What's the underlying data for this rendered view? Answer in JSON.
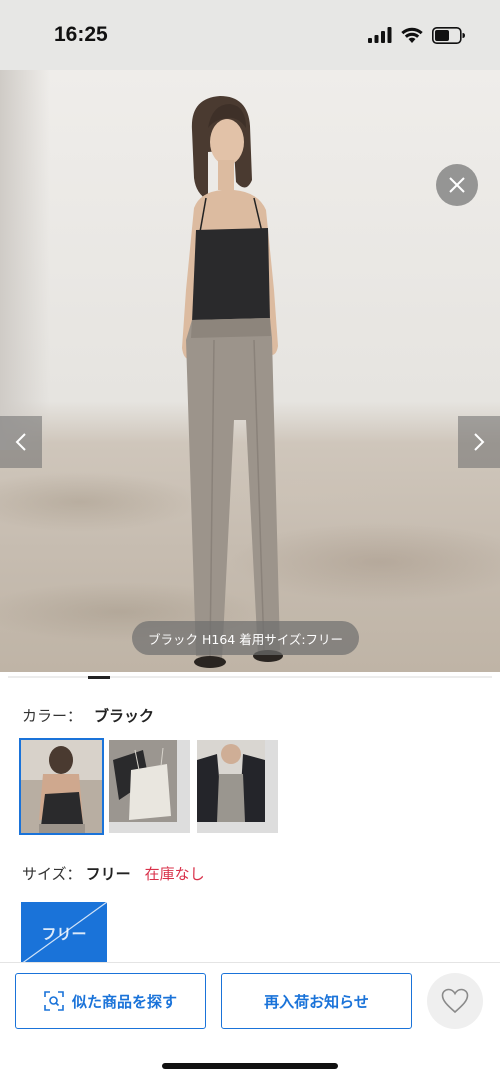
{
  "status_bar": {
    "time": "16:25",
    "icons": [
      "signal-icon",
      "wifi-icon",
      "battery-icon"
    ]
  },
  "hero": {
    "caption": "ブラック H164 着用サイズ:フリー",
    "close_icon": "close-icon",
    "prev_icon": "chevron-left-icon",
    "next_icon": "chevron-right-icon"
  },
  "color": {
    "label": "カラー：",
    "value": "ブラック",
    "swatches": [
      {
        "name": "black",
        "selected": true
      },
      {
        "name": "white",
        "selected": false
      },
      {
        "name": "gray",
        "selected": false
      }
    ]
  },
  "size": {
    "label": "サイズ：",
    "value": "フリー",
    "stock": "在庫なし",
    "option": "フリー"
  },
  "actions": {
    "similar_label": "似た商品を探す",
    "restock_label": "再入荷お知らせ",
    "favorite_icon": "heart-icon"
  },
  "colors": {
    "accent": "#1a73d9",
    "stock_red": "#d9314a"
  }
}
